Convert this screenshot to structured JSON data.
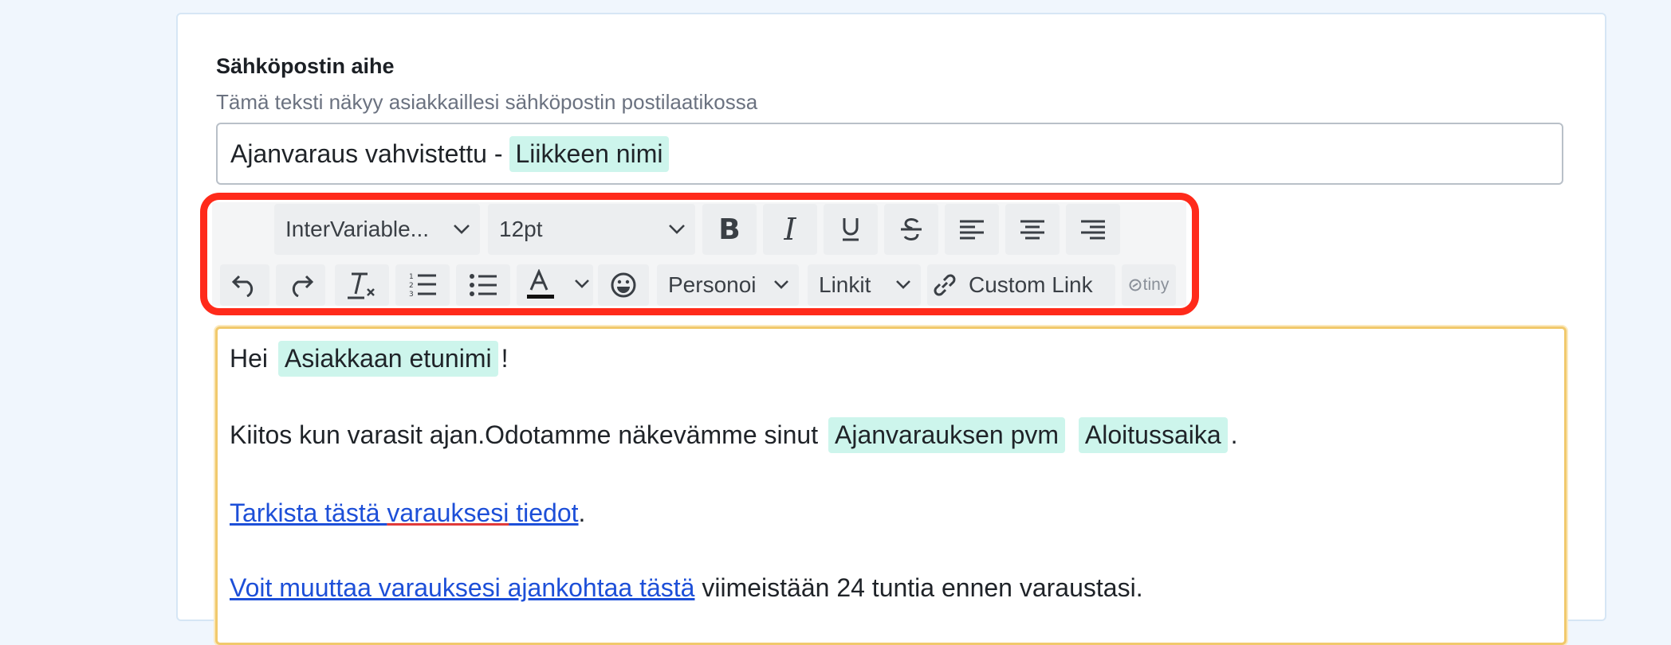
{
  "subject": {
    "label": "Sähköpostin aihe",
    "help": "Tämä teksti näkyy asiakkaillesi sähköpostin postilaatikossa",
    "value_prefix": "Ajanvaraus vahvistettu -",
    "value_chip": "Liikkeen nimi"
  },
  "toolbar": {
    "font_family": "InterVariable...",
    "font_size": "12pt",
    "personoi_label": "Personoi",
    "linkit_label": "Linkit",
    "custom_link_label": "Custom Link",
    "brand": "tiny",
    "highlight_color": "#ff2a1a"
  },
  "editor": {
    "greeting": "Hei",
    "greeting_chip": "Asiakkaan etunimi",
    "greeting_end": "!",
    "thanks_text": "Kiitos kun varasit ajan.Odotamme näkevämme sinut",
    "chip_date": "Ajanvarauksen pvm",
    "chip_time": "Aloitussaika",
    "thanks_end": ".",
    "link1_a": "Tarkista tästä ",
    "link1_b": "varauksesi",
    "link1_c": " tiedot",
    "link1_end": ".",
    "link2": "Voit muuttaa varauksesi ajankohtaa tästä",
    "link2_rest": " viimeistään 24 tuntia ennen varaustasi."
  }
}
